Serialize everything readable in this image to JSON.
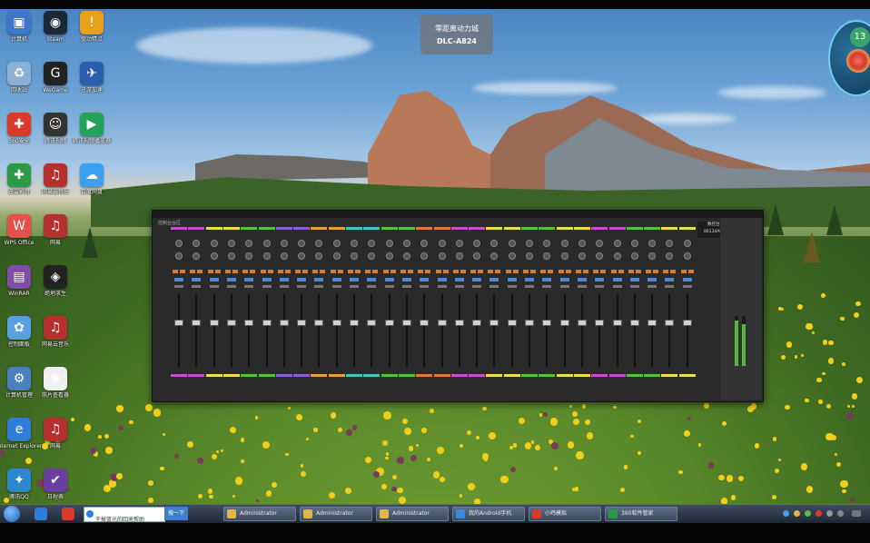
{
  "desktop": {
    "icons": [
      {
        "label": "计算机",
        "color": "#3b78c9",
        "glyph": "▣"
      },
      {
        "label": "Steam",
        "color": "#1b2838",
        "glyph": "◉"
      },
      {
        "label": "驱动精灵",
        "color": "#e8a11a",
        "glyph": "!"
      },
      {
        "label": "回收站",
        "color": "#8ab0d4",
        "glyph": "♻"
      },
      {
        "label": "WeGame",
        "color": "#222222",
        "glyph": "G"
      },
      {
        "label": "迅游加速",
        "color": "#2b5fab",
        "glyph": "✈"
      },
      {
        "label": "360安全",
        "color": "#d93a2a",
        "glyph": "✚"
      },
      {
        "label": "腾讯视频",
        "color": "#333333",
        "glyph": "☺"
      },
      {
        "label": "腾讯视频播放器",
        "color": "#22a35a",
        "glyph": "▶"
      },
      {
        "label": "迅雷影音",
        "color": "#2a9a46",
        "glyph": "✚"
      },
      {
        "label": "网易云音乐",
        "color": "#b5312e",
        "glyph": "♫"
      },
      {
        "label": "百度网盘",
        "color": "#3aa0f0",
        "glyph": "☁"
      },
      {
        "label": "WPS Office",
        "color": "#e6504a",
        "glyph": "W"
      },
      {
        "label": "网易",
        "color": "#b5312e",
        "glyph": "♫"
      },
      {
        "label": "WinRAR",
        "color": "#7f4ca8",
        "glyph": "▤"
      },
      {
        "label": "绝地求生",
        "color": "#222222",
        "glyph": "◈"
      },
      {
        "label": "控制面板",
        "color": "#5aa0e0",
        "glyph": "✿"
      },
      {
        "label": "网易云音乐",
        "color": "#b5312e",
        "glyph": "♫"
      },
      {
        "label": "计算机管理",
        "color": "#4a7fc0",
        "glyph": "⚙"
      },
      {
        "label": "照片查看器",
        "color": "#f0f0f0",
        "glyph": "❀"
      },
      {
        "label": "Internet Explorer",
        "color": "#2f7fd8",
        "glyph": "e"
      },
      {
        "label": "网易",
        "color": "#b5312e",
        "glyph": "♫"
      },
      {
        "label": "腾讯QQ",
        "color": "#2d87d0",
        "glyph": "✦"
      },
      {
        "label": "日程表",
        "color": "#6b3fa0",
        "glyph": "✔"
      }
    ]
  },
  "tooltip": {
    "line1": "零距离动力城",
    "line2": "DLC-A824"
  },
  "widget": {
    "number": "13"
  },
  "mixer": {
    "header": "控制台台区",
    "device_line1": "数控台面",
    "device_line2": "86134A924",
    "channels": [
      {
        "color": "#c94fd0"
      },
      {
        "color": "#c94fd0"
      },
      {
        "color": "#e9e24a"
      },
      {
        "color": "#e9e24a"
      },
      {
        "color": "#56c23e"
      },
      {
        "color": "#56c23e"
      },
      {
        "color": "#8a60d8"
      },
      {
        "color": "#8a60d8"
      },
      {
        "color": "#e6a13a"
      },
      {
        "color": "#e6a13a"
      },
      {
        "color": "#3cc6c0"
      },
      {
        "color": "#3cc6c0"
      },
      {
        "color": "#56c23e"
      },
      {
        "color": "#56c23e"
      },
      {
        "color": "#e07a3a"
      },
      {
        "color": "#e07a3a"
      },
      {
        "color": "#c94fd0"
      },
      {
        "color": "#c94fd0"
      },
      {
        "color": "#e9e24a"
      },
      {
        "color": "#e9e24a"
      },
      {
        "color": "#56c23e"
      },
      {
        "color": "#56c23e"
      },
      {
        "color": "#e9e24a"
      },
      {
        "color": "#e9e24a"
      },
      {
        "color": "#c94fd0"
      },
      {
        "color": "#c94fd0"
      },
      {
        "color": "#56c23e"
      },
      {
        "color": "#56c23e"
      },
      {
        "color": "#e9e24a"
      },
      {
        "color": "#e9e24a"
      }
    ]
  },
  "taskbar": {
    "search_text": "干掉蓝光的回来帮助",
    "search_button": "搜一下",
    "tasks": [
      {
        "label": "Administrator",
        "color": "#e0b64a"
      },
      {
        "label": "Administrator",
        "color": "#e0b64a"
      },
      {
        "label": "Administrator",
        "color": "#e0b64a"
      },
      {
        "label": "我的Android手机",
        "color": "#3a8ad8"
      },
      {
        "label": "小鸡模拟",
        "color": "#d93a2a"
      },
      {
        "label": "360软件管家",
        "color": "#2a9a46"
      }
    ]
  }
}
